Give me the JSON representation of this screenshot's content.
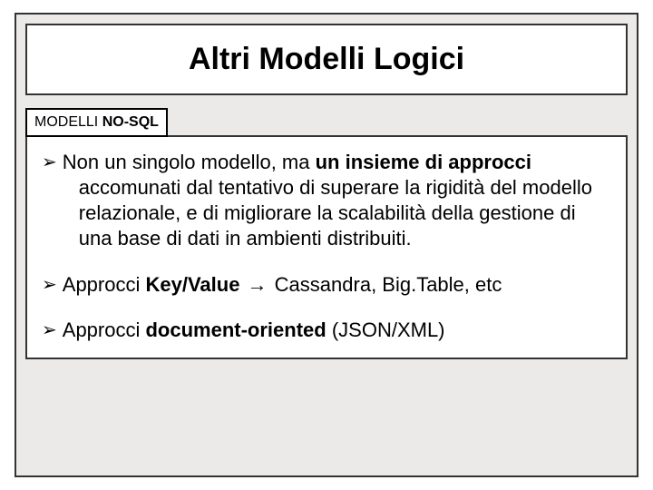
{
  "title": "Altri Modelli Logici",
  "subheader": {
    "prefix": "MODELLI ",
    "bold": "NO-SQL"
  },
  "bullets": {
    "b1": {
      "lead": "Non un singolo modello, ma ",
      "bold1": "un insieme di approcci",
      "rest": " accomunati dal tentativo di superare la rigidità del modello relazionale, e di migliorare la scalabilità della gestione di una base di dati in ambienti distribuiti."
    },
    "b2": {
      "lead": "Approcci ",
      "bold": "Key/Value",
      "arrow": " → ",
      "tail": "Cassandra, Big.Table, etc"
    },
    "b3": {
      "lead": "Approcci ",
      "bold": "document-oriented",
      "tail": " (JSON/XML)"
    }
  },
  "chart_data": {
    "type": "table",
    "title": "Altri Modelli Logici",
    "section": "MODELLI NO-SQL",
    "items": [
      "Non un singolo modello, ma un insieme di approcci accomunati dal tentativo di superare la rigidità del modello relazionale, e di migliorare la scalabilità della gestione di una base di dati in ambienti distribuiti.",
      "Approcci Key/Value → Cassandra, Big.Table, etc",
      "Approcci document-oriented (JSON/XML)"
    ]
  }
}
